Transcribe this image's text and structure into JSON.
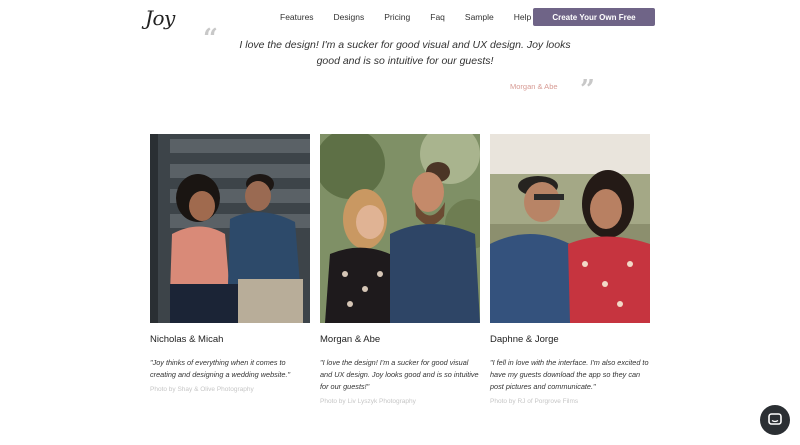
{
  "header": {
    "logo": "Joy",
    "nav": [
      "Features",
      "Designs",
      "Pricing",
      "Faq",
      "Sample",
      "Help"
    ],
    "cta": "Create Your Own Free"
  },
  "testimonial": {
    "quote": "I love the design! I'm a sucker for good visual and UX design. Joy looks good and is so intuitive for our guests!",
    "author": "Morgan & Abe"
  },
  "cards": [
    {
      "names": "Nicholas & Micah",
      "text": "\"Joy thinks of everything when it comes to creating and designing a wedding website.\"",
      "credit": "Photo by Shay & Olive Photography"
    },
    {
      "names": "Morgan & Abe",
      "text": "\"I love the design! I'm a sucker for good visual and UX design. Joy looks good and is so intuitive for our guests!\"",
      "credit": "Photo by Liv Lyszyk Photography"
    },
    {
      "names": "Daphne & Jorge",
      "text": "\"I fell in love with the interface. I'm also excited to have my guests download the app so they can post pictures and communicate.\"",
      "credit": "Photo by RJ of Porgrove Films"
    }
  ],
  "colors": {
    "cta_bg": "#6f6487",
    "author": "#d79b94",
    "chat_bg": "#2b2f33"
  },
  "icons": {
    "chat": "chat-bubble-icon",
    "quote_open": "open-quote-icon",
    "quote_close": "close-quote-icon"
  }
}
